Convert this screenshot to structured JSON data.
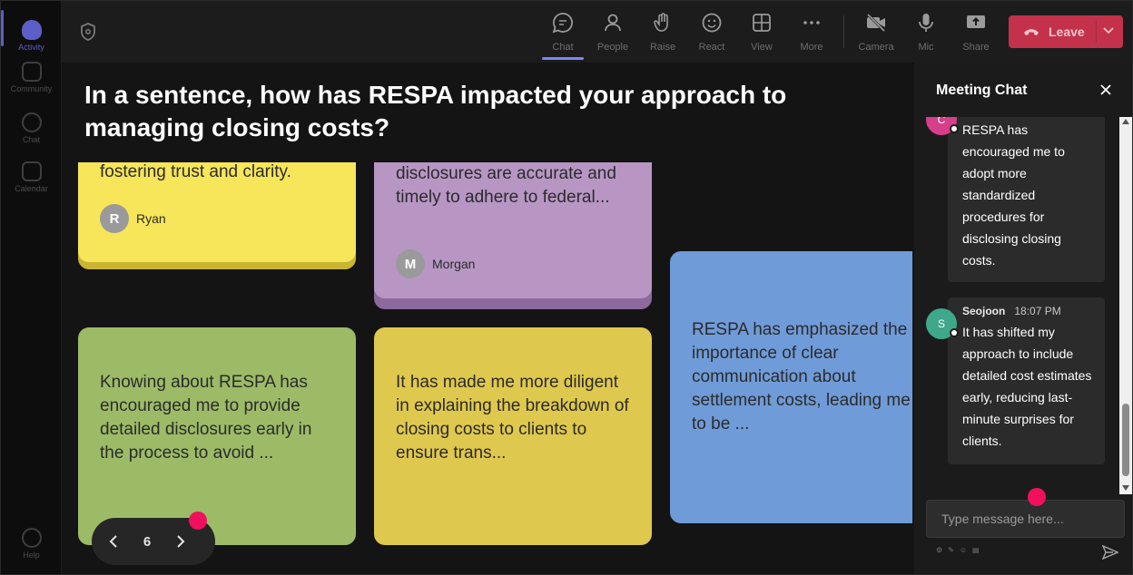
{
  "rail": {
    "items": [
      {
        "label": "Activity",
        "active": true
      },
      {
        "label": "Community"
      },
      {
        "label": "Chat"
      },
      {
        "label": "Calendar"
      },
      {
        "label": "Help"
      }
    ]
  },
  "toolbar": {
    "items": [
      "Chat",
      "People",
      "Raise",
      "React",
      "View",
      "More",
      "Camera",
      "Mic",
      "Share"
    ],
    "leave_label": "Leave",
    "accent": "#7f85f5",
    "leave_color": "#c4314b"
  },
  "stage": {
    "question": "In a sentence, how has RESPA impacted your approach to managing closing costs?",
    "cards": [
      {
        "text": "fostering trust and clarity.",
        "author": "Ryan",
        "initial": "R",
        "color": "#f7e55a"
      },
      {
        "text": "disclosures are accurate and timely to adhere to federal...",
        "author": "Morgan",
        "initial": "M",
        "color": "#b796c4"
      },
      {
        "text": "RESPA has emphasized the importance of clear communication about settlement costs, leading me to be ...",
        "color": "#6f9bd8"
      },
      {
        "text": "Knowing about RESPA has encouraged me to provide detailed disclosures early in the process to avoid ...",
        "color": "#9dbb67"
      },
      {
        "text": "It has made me more diligent in explaining the breakdown of closing costs to clients to ensure trans...",
        "color": "#dfc84e"
      }
    ],
    "page": "6"
  },
  "chat": {
    "title": "Meeting Chat",
    "messages": [
      {
        "avatar": "C",
        "avatar_color": "#d63f8c",
        "sender": "",
        "time": "",
        "text": "RESPA has encouraged me to adopt more standardized procedures for disclosing closing costs."
      },
      {
        "avatar": "S",
        "avatar_color": "#3fa88b",
        "sender": "Seojoon",
        "time": "18:07 PM",
        "text": "It has shifted my approach to include detailed cost estimates early, reducing last-minute surprises for clients."
      }
    ],
    "placeholder": "Type message here..."
  }
}
